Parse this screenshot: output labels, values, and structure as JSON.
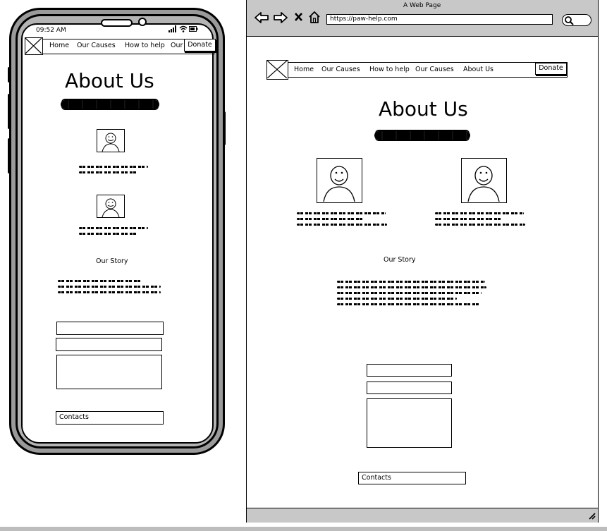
{
  "mobile": {
    "status": {
      "time": "09:52 AM",
      "signal_icon": "signal-icon",
      "wifi_icon": "wifi-icon",
      "battery_icon": "battery-icon"
    },
    "nav": {
      "items": [
        "Home",
        "Our Causes",
        "How to help",
        "Our"
      ],
      "donate": "Donate",
      "logo_icon": "image-placeholder-icon"
    },
    "title": "About Us",
    "story_heading": "Our Story",
    "contacts_label": "Contacts"
  },
  "browser": {
    "window_title": "A Web Page",
    "url": "https://paw-help.com",
    "controls": [
      "back-arrow-icon",
      "forward-arrow-icon",
      "close-x-icon",
      "home-icon",
      "search-icon"
    ],
    "nav": {
      "items": [
        "Home",
        "Our Causes",
        "How to help",
        "Our Causes",
        "About Us"
      ],
      "donate": "Donate",
      "logo_icon": "image-placeholder-icon"
    },
    "title": "About Us",
    "story_heading": "Our Story",
    "contacts_label": "Contacts"
  },
  "colors": {
    "frame_gray": "#9a9a9a",
    "chrome_gray": "#c8c8c8",
    "ink": "#000000",
    "paper": "#ffffff"
  }
}
